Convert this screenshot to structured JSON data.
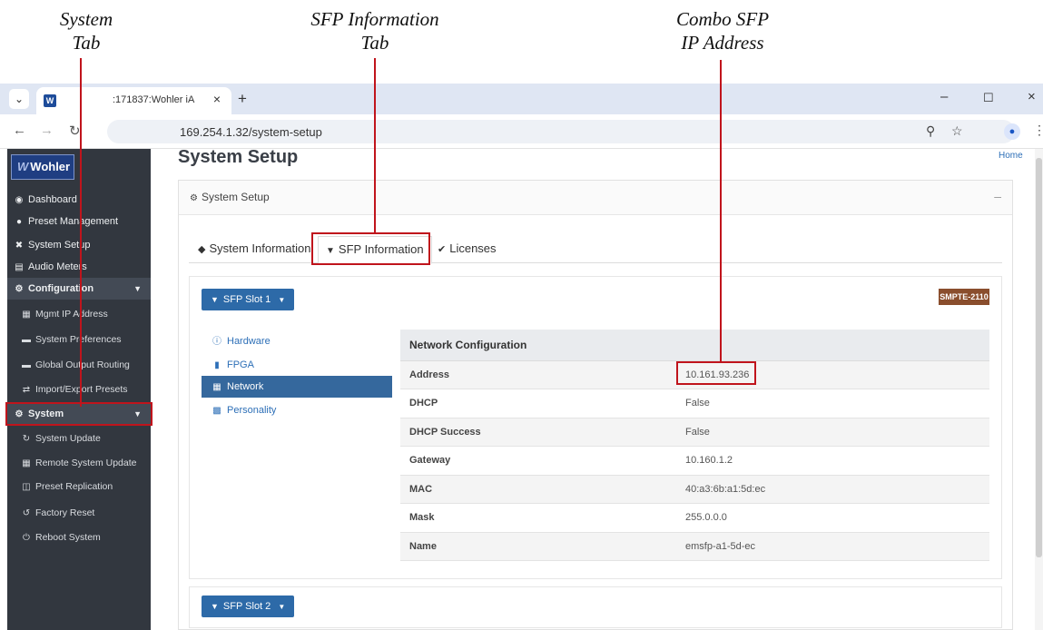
{
  "annotations": {
    "system_tab": [
      "System",
      "Tab"
    ],
    "sfp_info_tab": [
      "SFP Information",
      "Tab"
    ],
    "combo_sfp_ip": [
      "Combo SFP",
      "IP Address"
    ]
  },
  "browser": {
    "tab_title": ":171837:Wohler iA",
    "url": "169.254.1.32/system-setup"
  },
  "sidebar": {
    "logo": "Wohler",
    "items": [
      {
        "label": "Dashboard",
        "icon": "tachometer-icon"
      },
      {
        "label": "Preset Management",
        "icon": "users-icon"
      },
      {
        "label": "System Setup",
        "icon": "tools-icon"
      },
      {
        "label": "Audio Meters",
        "icon": "meter-icon"
      },
      {
        "label": "Configuration",
        "icon": "gear-icon"
      },
      {
        "label": "Mgmt IP Address",
        "icon": "network-icon"
      },
      {
        "label": "System Preferences",
        "icon": "card-icon"
      },
      {
        "label": "Global Output Routing",
        "icon": "card-icon"
      },
      {
        "label": "Import/Export Presets",
        "icon": "transfer-icon"
      },
      {
        "label": "System",
        "icon": "gears-icon"
      },
      {
        "label": "System Update",
        "icon": "refresh-icon"
      },
      {
        "label": "Remote System Update",
        "icon": "network-icon"
      },
      {
        "label": "Preset Replication",
        "icon": "database-icon"
      },
      {
        "label": "Factory Reset",
        "icon": "undo-icon"
      },
      {
        "label": "Reboot System",
        "icon": "power-icon"
      }
    ]
  },
  "main": {
    "title": "System Setup",
    "home_link": "Home",
    "panel_title": "System Setup",
    "tabs": [
      {
        "label": "System Information"
      },
      {
        "label": "SFP Information"
      },
      {
        "label": "Licenses"
      }
    ],
    "slot1_label": "SFP Slot 1",
    "slot2_label": "SFP Slot 2",
    "badge": "SMPTE-2110",
    "subnav": [
      {
        "label": "Hardware"
      },
      {
        "label": "FPGA"
      },
      {
        "label": "Network"
      },
      {
        "label": "Personality"
      }
    ],
    "network": {
      "header": "Network Configuration",
      "rows": [
        {
          "key": "Address",
          "value": "10.161.93.236"
        },
        {
          "key": "DHCP",
          "value": "False"
        },
        {
          "key": "DHCP Success",
          "value": "False"
        },
        {
          "key": "Gateway",
          "value": "10.160.1.2"
        },
        {
          "key": "MAC",
          "value": "40:a3:6b:a1:5d:ec"
        },
        {
          "key": "Mask",
          "value": "255.0.0.0"
        },
        {
          "key": "Name",
          "value": "emsfp-a1-5d-ec"
        }
      ]
    }
  },
  "colors": {
    "annotation_red": "#c0141c",
    "sidebar_bg": "#32373f",
    "accent_blue": "#2d6aa8",
    "badge_brown": "#8a4e2d"
  }
}
